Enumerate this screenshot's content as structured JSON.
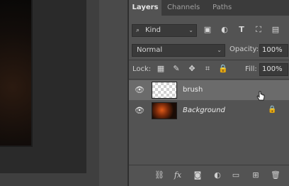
{
  "tabs": {
    "layers": "Layers",
    "channels": "Channels",
    "paths": "Paths"
  },
  "filter": {
    "kind_label": "Kind"
  },
  "blend": {
    "mode": "Normal",
    "opacity_label": "Opacity:",
    "opacity_value": "100%"
  },
  "lock": {
    "label": "Lock:",
    "fill_label": "Fill:",
    "fill_value": "100%"
  },
  "layers": [
    {
      "name": "brush",
      "selected": true
    },
    {
      "name": "Background",
      "selected": false,
      "locked": true
    }
  ],
  "footer": {
    "fx_label": "fx"
  }
}
